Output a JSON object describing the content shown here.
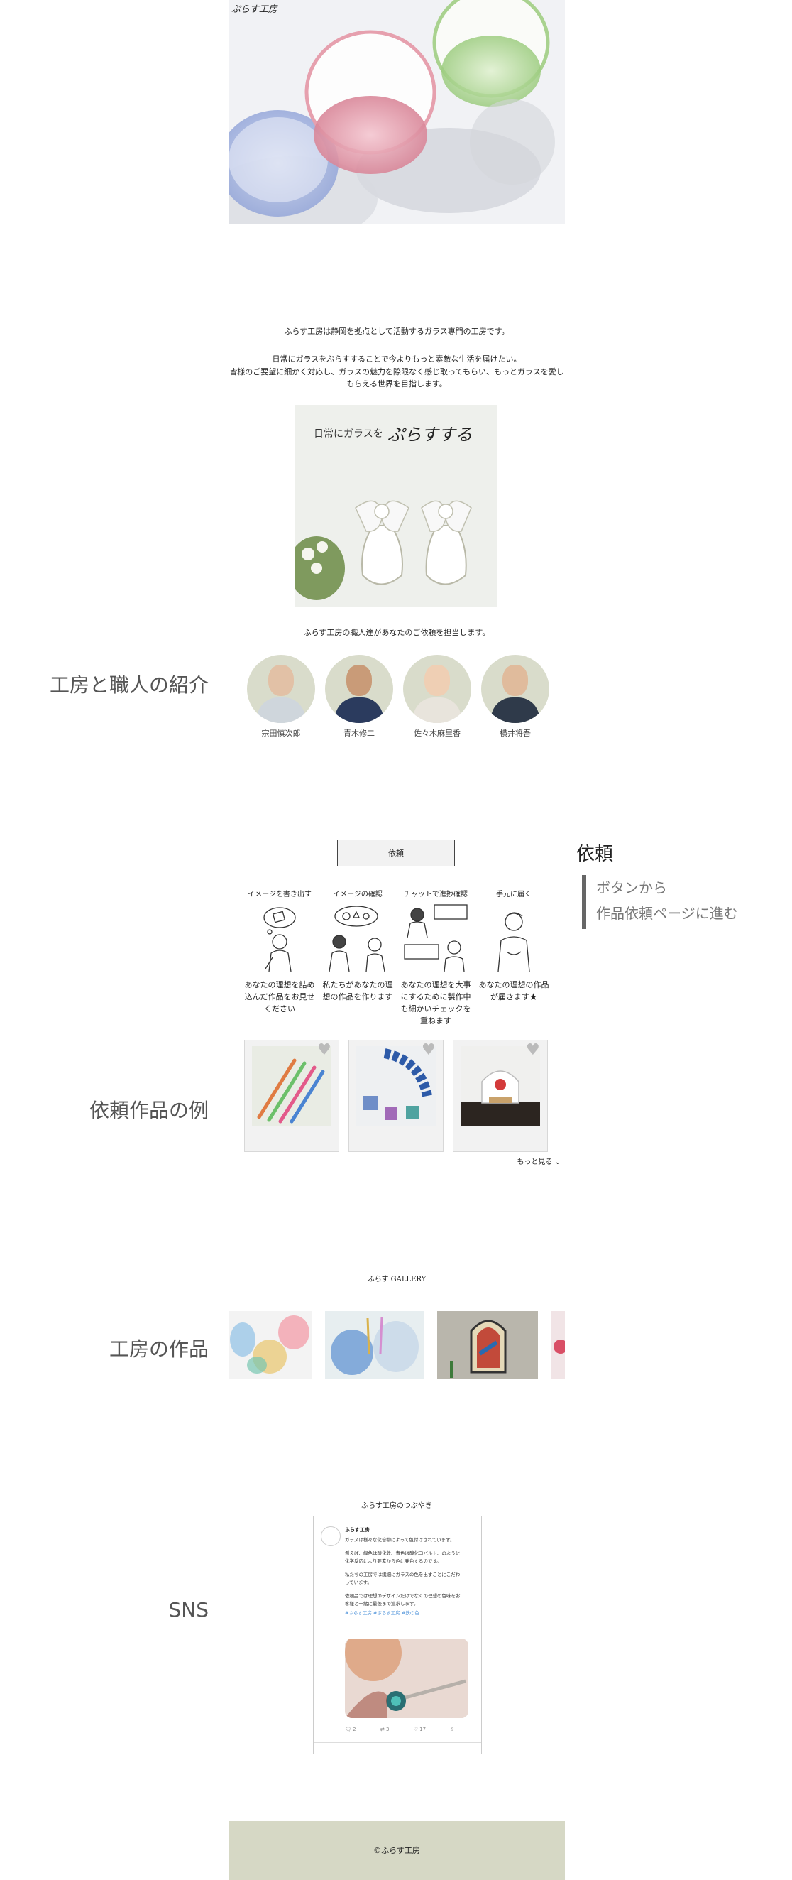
{
  "brand": {
    "logo_text": "ぷらす工房"
  },
  "intro": {
    "line1": "ふらす工房は静岡を拠点として活動するガラス専門の工房です。",
    "line2": "日常にガラスをぷらすすることで今よりもっと素敵な生活を届けたい。",
    "line3": "皆様のご要望に細かく対応し、ガラスの魅力を際限なく感じ取ってもらい、もっとガラスを愛して",
    "line4": "もらえる世界を目指します。",
    "banner_text": "日常にガラスを",
    "banner_script": "ぷらすする"
  },
  "craftsmen": {
    "section_label": "工房と職人の紹介",
    "lead": "ふらす工房の職人達があなたのご依頼を担当します。",
    "people": [
      {
        "name": "宗田慎次郎"
      },
      {
        "name": "青木修二"
      },
      {
        "name": "佐々木麻里香"
      },
      {
        "name": "横井将吾"
      }
    ]
  },
  "request": {
    "button_label": "依頼",
    "annotation_title": "依頼",
    "annotation_line1": "ボタンから",
    "annotation_line2": "作品依頼ページに進む",
    "steps": [
      {
        "title": "イメージを書き出す",
        "desc": "あなたの理想を詰め込んだ作品をお見せください"
      },
      {
        "title": "イメージの確認",
        "desc": "私たちがあなたの理想の作品を作ります"
      },
      {
        "title": "チャットで進捗確認",
        "desc": "あなたの理想を大事にするために製作中も細かいチェックを重ねます"
      },
      {
        "title": "手元に届く",
        "desc": "あなたの理想の作品が届きます★"
      }
    ]
  },
  "examples": {
    "section_label": "依頼作品の例",
    "more_label": "もっと見る ⌄",
    "items": [
      {
        "name": "glass-pens"
      },
      {
        "name": "stained-accessories"
      },
      {
        "name": "glass-dome"
      }
    ]
  },
  "gallery": {
    "section_label": "工房の作品",
    "title": "ふらす GALLERY"
  },
  "sns": {
    "section_label": "SNS",
    "title": "ふらす工房のつぶやき",
    "account": "ふらす工房",
    "t1": "ガラスは様々な化合物によって色付けされています。",
    "t2": "例えば、緑色は酸化鉄、青色は酸化コバルト、のように",
    "t3": "化学反応により要素から色に発色するのです。",
    "t4": "私たちの工房では繊細にガラスの色を出すことにこだわ",
    "t5": "っています。",
    "t6": "依頼品では理想のデザインだけでなくの理想の色味をお",
    "t7": "客様と一緒に最後まで追求します。",
    "hashtags": "#ふらす工房 #ぷらす工房 #鉄の色",
    "reply_count": "2",
    "retweet_count": "3",
    "like_count": "17"
  },
  "footer": {
    "copyright": "©ふらす工房"
  },
  "colors": {
    "avatar_bg": "#d9dccb",
    "footer_bg": "#d6d8c5",
    "accent_bar": "#666666"
  }
}
